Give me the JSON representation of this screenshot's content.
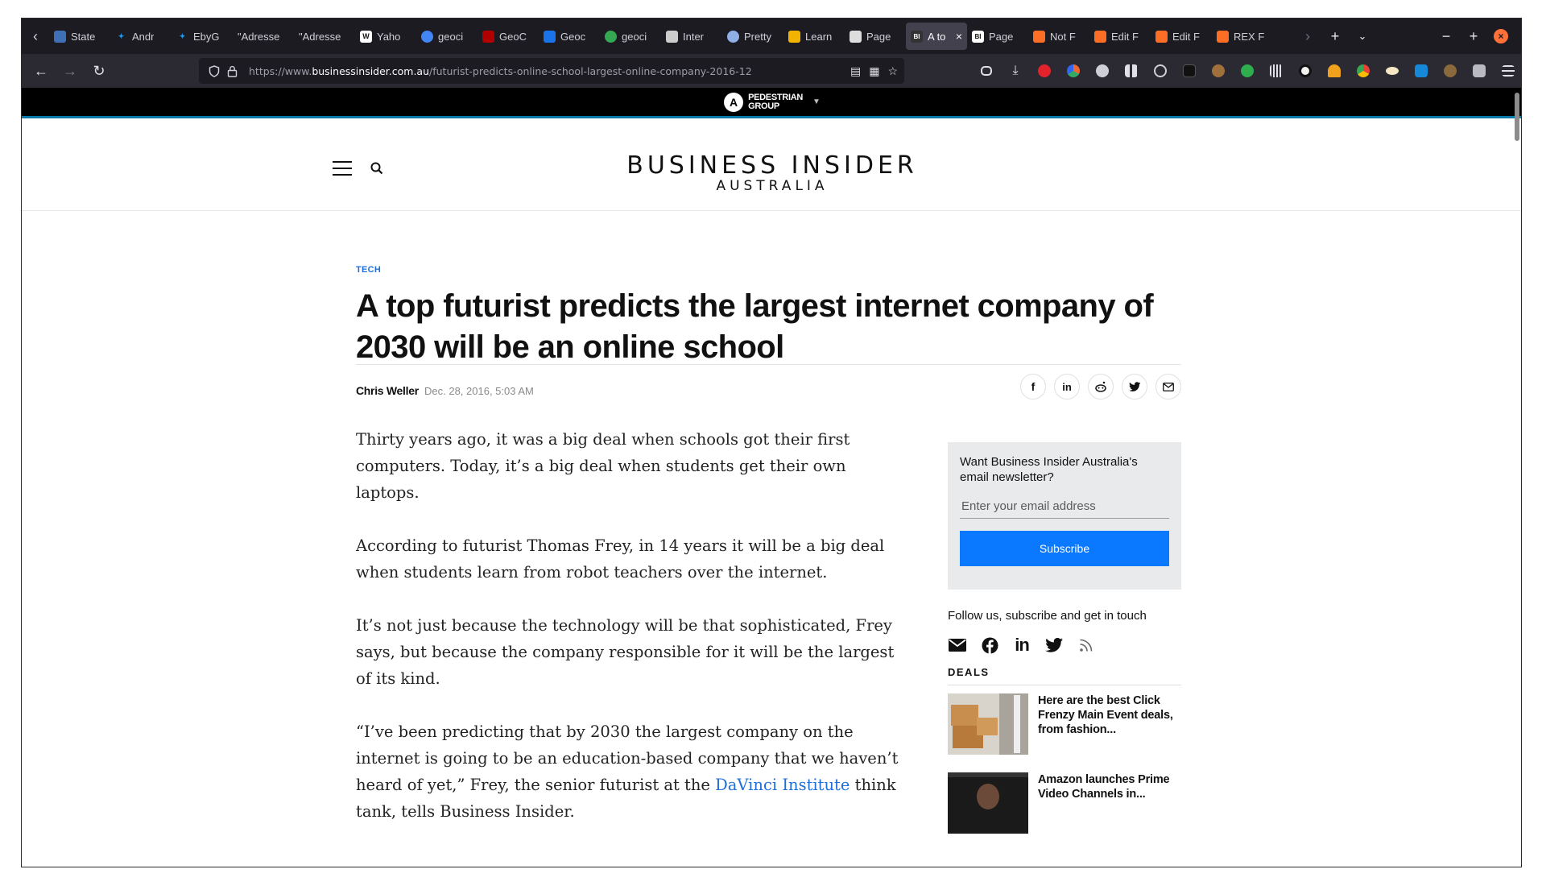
{
  "browser": {
    "tabs": [
      {
        "label": "State",
        "favicon": "people-favicon",
        "color": "#3f6fb5"
      },
      {
        "label": "Andr",
        "favicon": "twitter-favicon",
        "color": "#1d9bf0"
      },
      {
        "label": "EbyG",
        "favicon": "twitter-favicon",
        "color": "#1d9bf0"
      },
      {
        "label": "\"Adresse",
        "favicon": "none",
        "color": ""
      },
      {
        "label": "\"Adresse",
        "favicon": "none",
        "color": ""
      },
      {
        "label": "Yaho",
        "favicon": "wikipedia-favicon",
        "color": "#ffffff"
      },
      {
        "label": "geoci",
        "favicon": "google-favicon",
        "color": "#4285f4"
      },
      {
        "label": "GeoC",
        "favicon": "geo-favicon",
        "color": "#b00000"
      },
      {
        "label": "Geoc",
        "favicon": "g-favicon",
        "color": "#1a73e8"
      },
      {
        "label": "geoci",
        "favicon": "chrome-favicon",
        "color": "#34a853"
      },
      {
        "label": "Inter",
        "favicon": "archive-favicon",
        "color": "#cccccc"
      },
      {
        "label": "Pretty",
        "favicon": "globe-favicon",
        "color": "#8fb0e6"
      },
      {
        "label": "Learn",
        "favicon": "learn-favicon",
        "color": "#f2b300"
      },
      {
        "label": "Page",
        "favicon": "page-favicon",
        "color": "#dddddd"
      },
      {
        "label": "A to",
        "favicon": "bi-favicon",
        "color": "#333333",
        "active": true
      },
      {
        "label": "Page",
        "favicon": "bi-favicon",
        "color": "#ffffff"
      },
      {
        "label": "Not F",
        "favicon": "gitlab-favicon",
        "color": "#fc6d26"
      },
      {
        "label": "Edit F",
        "favicon": "gitlab-favicon",
        "color": "#fc6d26"
      },
      {
        "label": "Edit F",
        "favicon": "gitlab-favicon",
        "color": "#fc6d26"
      },
      {
        "label": "REX F",
        "favicon": "gitlab-favicon",
        "color": "#fc6d26"
      }
    ],
    "url_prefix": "https://www.",
    "url_domain": "businessinsider.com.au",
    "url_path": "/futurist-predicts-online-school-largest-online-company-2016-12",
    "accent": "#ff7139"
  },
  "page": {
    "pedestrian_line1": "PEDESTRIAN",
    "pedestrian_line2": "GROUP",
    "brand_main": "BUSINESS INSIDER",
    "brand_sub": "AUSTRALIA",
    "category": "TECH",
    "headline": "A top futurist predicts the largest internet company of 2030 will be an online school",
    "author": "Chris Weller",
    "date": "Dec. 28, 2016, 5:03 AM",
    "paragraphs": [
      "Thirty years ago, it was a big deal when schools got their first computers. Today, it’s a big deal when students get their own laptops.",
      "According to futurist Thomas Frey, in 14 years it will be a big deal when students learn from robot teachers over the internet.",
      "It’s not just because the technology will be that sophisticated, Frey says, but because the company responsible for it will be the largest of its kind."
    ],
    "p4_before": "“I’ve been predicting that by 2030 the largest company on the internet is going to be an education-based company that we haven’t heard of yet,” Frey, the senior futurist at the ",
    "p4_link": "DaVinci Institute",
    "p4_after": " think tank, tells Business Insider.",
    "link_color": "#1e6fd9"
  },
  "sidebar": {
    "newsletter_title": "Want Business Insider Australia's email newsletter?",
    "email_placeholder": "Enter your email address",
    "subscribe_label": "Subscribe",
    "subscribe_color": "#0a78ff",
    "follow_text": "Follow us, subscribe and get in touch",
    "deals_heading": "DEALS",
    "deals": [
      {
        "title": "Here are the best Click Frenzy Main Event deals, from fashion..."
      },
      {
        "title": "Amazon launches Prime Video Channels in..."
      }
    ]
  }
}
